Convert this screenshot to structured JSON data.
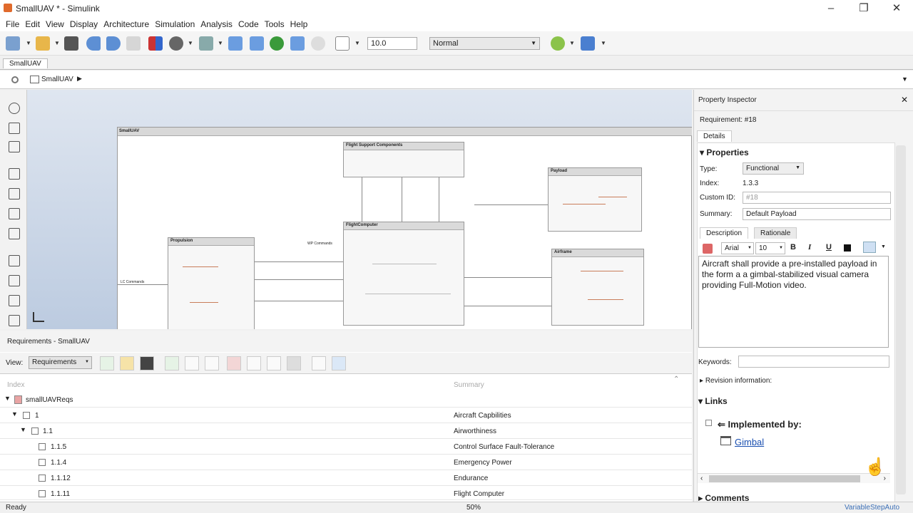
{
  "window": {
    "title": "SmallUAV * - Simulink",
    "minimize": "–",
    "maximize": "❐",
    "close": "✕"
  },
  "menu": [
    "File",
    "Edit",
    "View",
    "Display",
    "Architecture",
    "Simulation",
    "Analysis",
    "Code",
    "Tools",
    "Help"
  ],
  "toolbar": {
    "stop_time": "10.0",
    "mode": "Normal"
  },
  "tab": "SmallUAV",
  "breadcrumb": "SmallUAV",
  "diagram": {
    "title": "SmallUAV",
    "blocks": {
      "fsc": "Flight Support Components",
      "payload": "Payload",
      "fc": "FlightComputer",
      "prop": "Propulsion",
      "airframe": "Airframe"
    },
    "port_labels": {
      "wp": "WP Commands",
      "lc": "LC Commands"
    }
  },
  "inspector": {
    "title": "Property Inspector",
    "req_label": "Requirement: #18",
    "tab": "Details",
    "properties_heading": "Properties",
    "type_label": "Type:",
    "type_value": "Functional",
    "index_label": "Index:",
    "index_value": "1.3.3",
    "custom_id_label": "Custom ID:",
    "custom_id_value": "#18",
    "summary_label": "Summary:",
    "summary_value": "Default Payload",
    "desc_tab": "Description",
    "rationale_tab": "Rationale",
    "font": "Arial",
    "size": "10",
    "description": "Aircraft shall provide a pre-installed payload in the form a a gimbal-stabilized visual camera providing Full-Motion video.",
    "keywords_label": "Keywords:",
    "revision": "Revision information:",
    "links_heading": "Links",
    "implemented_by": "Implemented by:",
    "link": "Gimbal",
    "comments_heading": "Comments"
  },
  "requirements": {
    "title": "Requirements - SmallUAV",
    "view_label": "View:",
    "view_value": "Requirements",
    "col_index": "Index",
    "col_summary": "Summary",
    "rows": [
      {
        "index": "smallUAVReqs",
        "summary": ""
      },
      {
        "index": "1",
        "summary": "Aircraft Capbilities"
      },
      {
        "index": "1.1",
        "summary": "Airworthiness"
      },
      {
        "index": "1.1.5",
        "summary": "Control Surface Fault-Tolerance"
      },
      {
        "index": "1.1.4",
        "summary": "Emergency Power"
      },
      {
        "index": "1.1.12",
        "summary": "Endurance"
      },
      {
        "index": "1.1.11",
        "summary": "Flight Computer"
      }
    ]
  },
  "status": {
    "left": "Ready",
    "zoom": "50%",
    "solver": "VariableStepAuto"
  },
  "colors": {
    "accent": "#3b6fb6",
    "link": "#1a4fb0"
  }
}
